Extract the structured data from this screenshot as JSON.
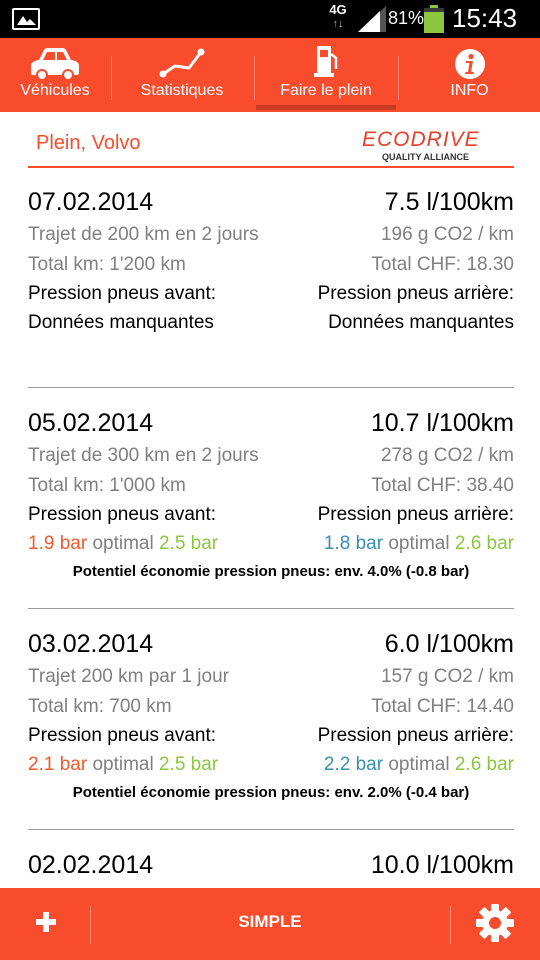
{
  "statusbar": {
    "network": "4G",
    "battery": "81%",
    "time": "15:43"
  },
  "nav": {
    "tabs": [
      {
        "label": "Véhicules",
        "icon": "car-icon"
      },
      {
        "label": "Statistiques",
        "icon": "line-chart-icon"
      },
      {
        "label": "Faire le plein",
        "icon": "fuel-pump-icon",
        "active": true
      },
      {
        "label": "INFO",
        "icon": "info-icon"
      }
    ]
  },
  "header": {
    "title": "Plein, Volvo",
    "logo_main": "ECODRIVE",
    "logo_sub": "QUALITY ALLIANCE"
  },
  "entries": [
    {
      "date": "07.02.2014",
      "consumption": "7.5 l/100km",
      "trip": "Trajet de 200 km en 2 jours",
      "co2": "196 g CO2 / km",
      "total_km": "Total km: 1'200 km",
      "total_chf": "Total CHF: 18.30",
      "front_label": "Pression pneus avant:",
      "rear_label": "Pression pneus arrière:",
      "front_missing": "Données manquantes",
      "rear_missing": "Données manquantes"
    },
    {
      "date": "05.02.2014",
      "consumption": "10.7 l/100km",
      "trip": "Trajet de 300 km en 2 jours",
      "co2": "278 g CO2 / km",
      "total_km": "Total km: 1'000 km",
      "total_chf": "Total CHF: 38.40",
      "front_label": "Pression pneus avant:",
      "rear_label": "Pression pneus arrière:",
      "front_value": "1.9 bar",
      "front_optimal_word": "optimal",
      "front_optimal": "2.5 bar",
      "rear_value": "1.8 bar",
      "rear_optimal_word": "optimal",
      "rear_optimal": "2.6 bar",
      "savings": "Potentiel économie pression pneus: env. 4.0% (-0.8 bar)"
    },
    {
      "date": "03.02.2014",
      "consumption": "6.0 l/100km",
      "trip": "Trajet 200 km par 1 jour",
      "co2": "157 g CO2 / km",
      "total_km": "Total km: 700 km",
      "total_chf": "Total CHF: 14.40",
      "front_label": "Pression pneus avant:",
      "rear_label": "Pression pneus arrière:",
      "front_value": "2.1 bar",
      "front_optimal_word": "optimal",
      "front_optimal": "2.5 bar",
      "rear_value": "2.2 bar",
      "rear_optimal_word": "optimal",
      "rear_optimal": "2.6 bar",
      "savings": "Potentiel économie pression pneus: env. 2.0% (-0.4 bar)"
    },
    {
      "date": "02.02.2014",
      "consumption": "10.0 l/100km"
    }
  ],
  "bottombar": {
    "add_icon": "plus-icon",
    "mode_label": "SIMPLE",
    "settings_icon": "gear-icon"
  },
  "colors": {
    "accent": "#f94c2c",
    "pressure_low": "#f05a2a",
    "pressure_optimal": "#8cc63f",
    "pressure_rear": "#3a8fb0"
  }
}
